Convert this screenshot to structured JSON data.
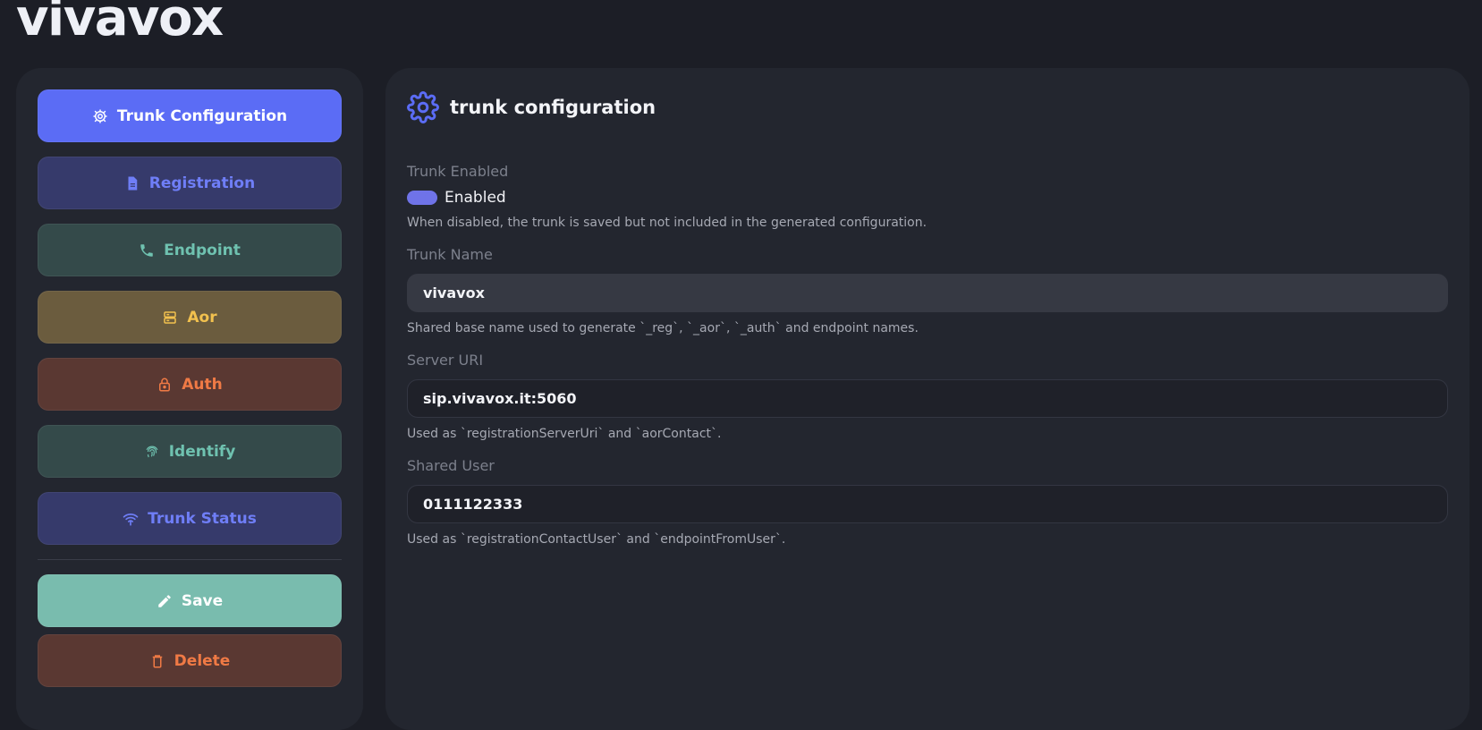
{
  "app": {
    "brand": "vivavox"
  },
  "sidebar": {
    "items": [
      {
        "label": "Trunk Configuration",
        "icon": "gear-icon"
      },
      {
        "label": "Registration",
        "icon": "document-icon"
      },
      {
        "label": "Endpoint",
        "icon": "phone-icon"
      },
      {
        "label": "Aor",
        "icon": "server-icon"
      },
      {
        "label": "Auth",
        "icon": "lock-icon"
      },
      {
        "label": "Identify",
        "icon": "fingerprint-icon"
      },
      {
        "label": "Trunk Status",
        "icon": "wifi-icon"
      }
    ],
    "save_label": "Save",
    "delete_label": "Delete"
  },
  "panel": {
    "title": "trunk configuration",
    "trunk_enabled": {
      "label": "Trunk Enabled",
      "toggle_label": "Enabled",
      "value": true,
      "help": "When disabled, the trunk is saved but not included in the generated configuration."
    },
    "trunk_name": {
      "label": "Trunk Name",
      "value": "vivavox",
      "help": "Shared base name used to generate `_reg`, `_aor`, `_auth` and endpoint names."
    },
    "server_uri": {
      "label": "Server URI",
      "value": "sip.vivavox.it:5060",
      "help": "Used as `registrationServerUri` and `aorContact`."
    },
    "shared_user": {
      "label": "Shared User",
      "value": "0111122333",
      "help": "Used as `registrationContactUser` and `endpointFromUser`."
    }
  },
  "colors": {
    "accent": "#5b6cf5",
    "teal": "#6fc2b0",
    "amber": "#f2c14e",
    "rust": "#f07a45"
  }
}
